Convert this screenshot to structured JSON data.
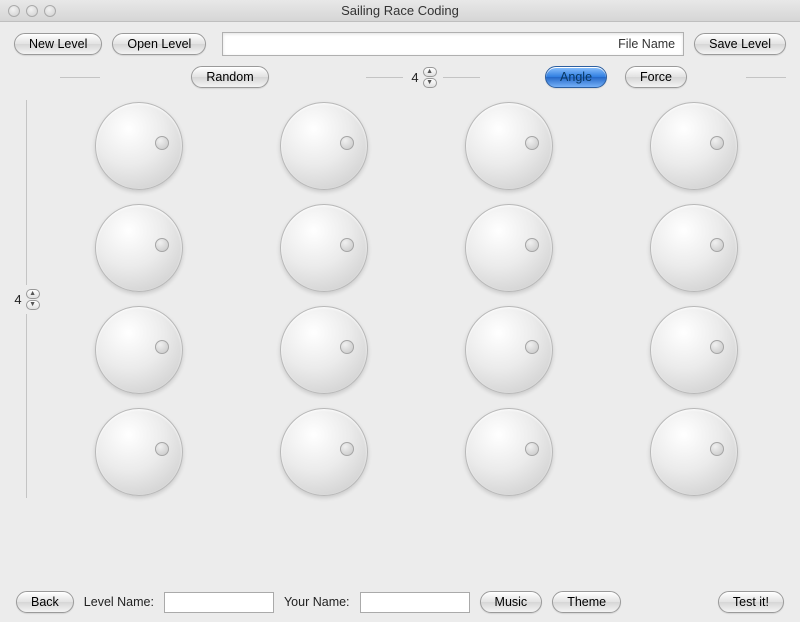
{
  "window": {
    "title": "Sailing Race Coding"
  },
  "toolbar": {
    "new_level": "New Level",
    "open_level": "Open Level",
    "file_name_label": "File Name",
    "file_name_value": "",
    "save_level": "Save Level"
  },
  "controls": {
    "random": "Random",
    "columns_value": "4",
    "rows_value": "4",
    "angle": "Angle",
    "force": "Force",
    "selected_mode": "Angle"
  },
  "grid": {
    "rows": 4,
    "cols": 4
  },
  "bottom": {
    "back": "Back",
    "level_name_label": "Level Name:",
    "level_name_value": "",
    "your_name_label": "Your Name:",
    "your_name_value": "",
    "music": "Music",
    "theme": "Theme",
    "test_it": "Test it!"
  }
}
